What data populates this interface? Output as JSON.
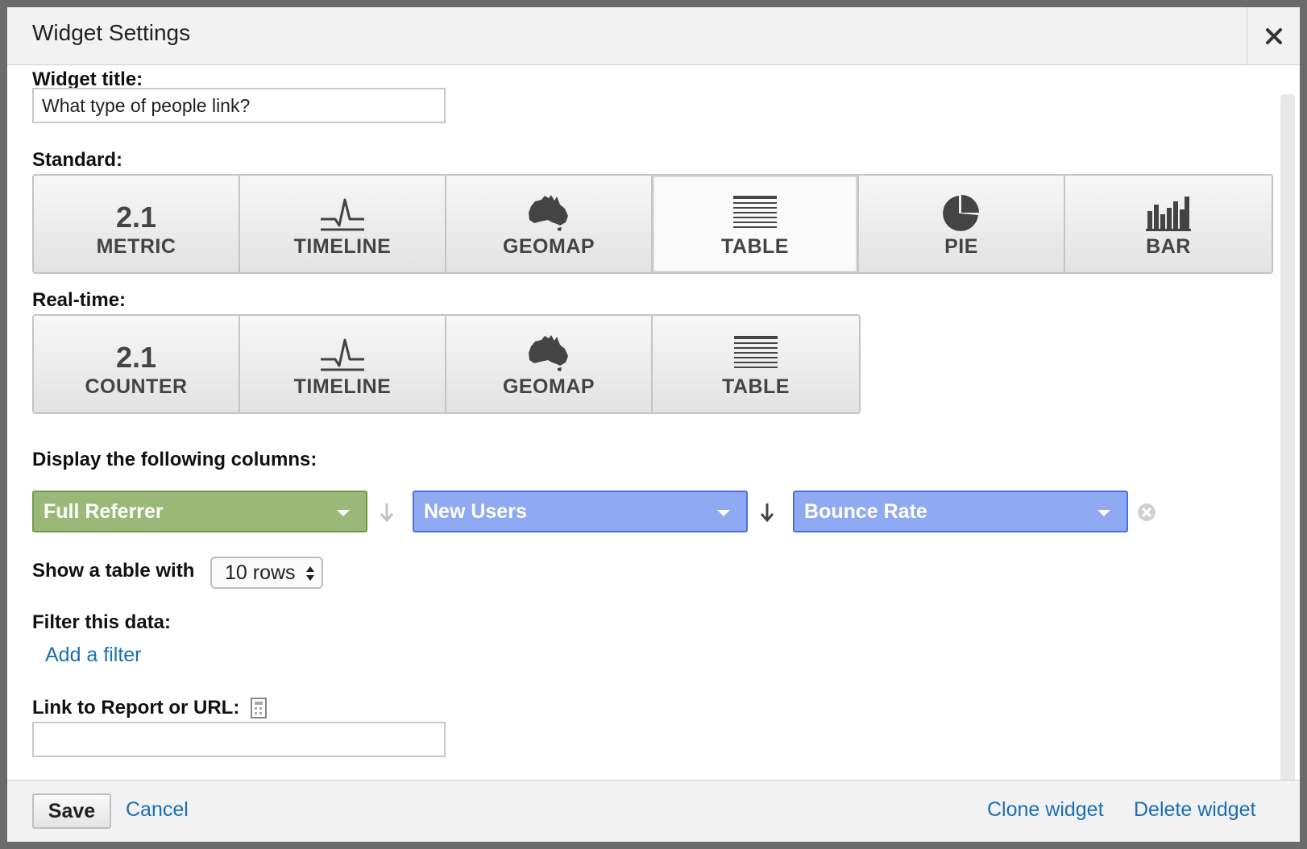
{
  "dialog": {
    "title": "Widget Settings"
  },
  "widget_title": {
    "label": "Widget title:",
    "value": "What type of people link?"
  },
  "standard": {
    "label": "Standard:",
    "selected": "TABLE",
    "buttons": [
      {
        "label": "METRIC",
        "icon": "metric-2.1-icon",
        "icon_text": "2.1"
      },
      {
        "label": "TIMELINE",
        "icon": "timeline-icon"
      },
      {
        "label": "GEOMAP",
        "icon": "australia-map-icon"
      },
      {
        "label": "TABLE",
        "icon": "table-lines-icon"
      },
      {
        "label": "PIE",
        "icon": "pie-chart-icon"
      },
      {
        "label": "BAR",
        "icon": "bar-chart-icon"
      }
    ]
  },
  "realtime": {
    "label": "Real-time:",
    "buttons": [
      {
        "label": "COUNTER",
        "icon": "counter-2.1-icon",
        "icon_text": "2.1"
      },
      {
        "label": "TIMELINE",
        "icon": "timeline-icon"
      },
      {
        "label": "GEOMAP",
        "icon": "australia-map-icon"
      },
      {
        "label": "TABLE",
        "icon": "table-lines-icon"
      }
    ]
  },
  "columns": {
    "label": "Display the following columns:",
    "items": [
      {
        "value": "Full Referrer",
        "color": "#9ab978"
      },
      {
        "value": "New Users",
        "color": "#8faaf2"
      },
      {
        "value": "Bounce Rate",
        "color": "#8faaf2"
      }
    ]
  },
  "rows": {
    "label": "Show a table with",
    "value": "10 rows"
  },
  "filter": {
    "label": "Filter this data:",
    "add_link": "Add a filter"
  },
  "link": {
    "label": "Link to Report or URL:",
    "value": ""
  },
  "footer": {
    "save": "Save",
    "cancel": "Cancel",
    "clone": "Clone widget",
    "delete": "Delete widget"
  }
}
